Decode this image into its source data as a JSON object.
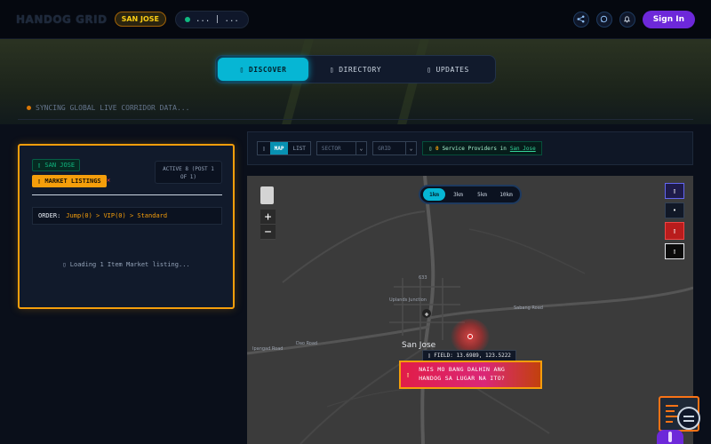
{
  "header": {
    "brand": "HANDOG GRID",
    "location_badge": "SAN JOSE",
    "status_text": "... | ...",
    "signin_label": "Sign In",
    "icons": [
      "share-icon",
      "chat-icon",
      "bell-icon"
    ]
  },
  "tabs": [
    {
      "label": "DISCOVER",
      "icon": "▯",
      "active": true
    },
    {
      "label": "DIRECTORY",
      "icon": "▯",
      "active": false
    },
    {
      "label": "UPDATES",
      "icon": "▯",
      "active": false
    }
  ],
  "sync_text": "SYNCING GLOBAL LIVE CORRIDOR DATA...",
  "left_panel": {
    "location_tag": "▯ SAN JOSE",
    "market_tag": "▯ MARKET LISTINGS",
    "market_close": "✕",
    "active_line1": "ACTIVE 8 (POST 1",
    "active_line2": "OF 1)",
    "order_label": "ORDER:",
    "order_value": "Jump(0) > VIP(0) > Standard",
    "loading_text": "▯ Loading 1 Item Market listing..."
  },
  "toolbar": {
    "view_icon": "▯",
    "map_label": "MAP",
    "list_label": "LIST",
    "sector_label": "SECTOR",
    "grid_label": "GRID",
    "caret": "⌄",
    "providers_icon": "▯",
    "providers_count": "0",
    "providers_text": "Service Providers in",
    "providers_location": "San Jose"
  },
  "map": {
    "radius_options": [
      "1km",
      "3km",
      "5km",
      "10km"
    ],
    "radius_selected": "1km",
    "zoom_in": "+",
    "zoom_out": "−",
    "side_buttons": [
      "▯",
      "•",
      "▯",
      "▯"
    ],
    "place_label": "San Jose",
    "small_labels": [
      "Sabang Road",
      "Dao Road",
      "Ipangad Road",
      "Uplands Junction",
      "633"
    ],
    "field_tip": "▯ FIELD: 13.6989, 123.5222",
    "cta_icon": "▯",
    "cta_line1": "NAIS MO BANG DALHIN ANG",
    "cta_line2": "HANDOG SA LUGAR NA ITO?"
  }
}
